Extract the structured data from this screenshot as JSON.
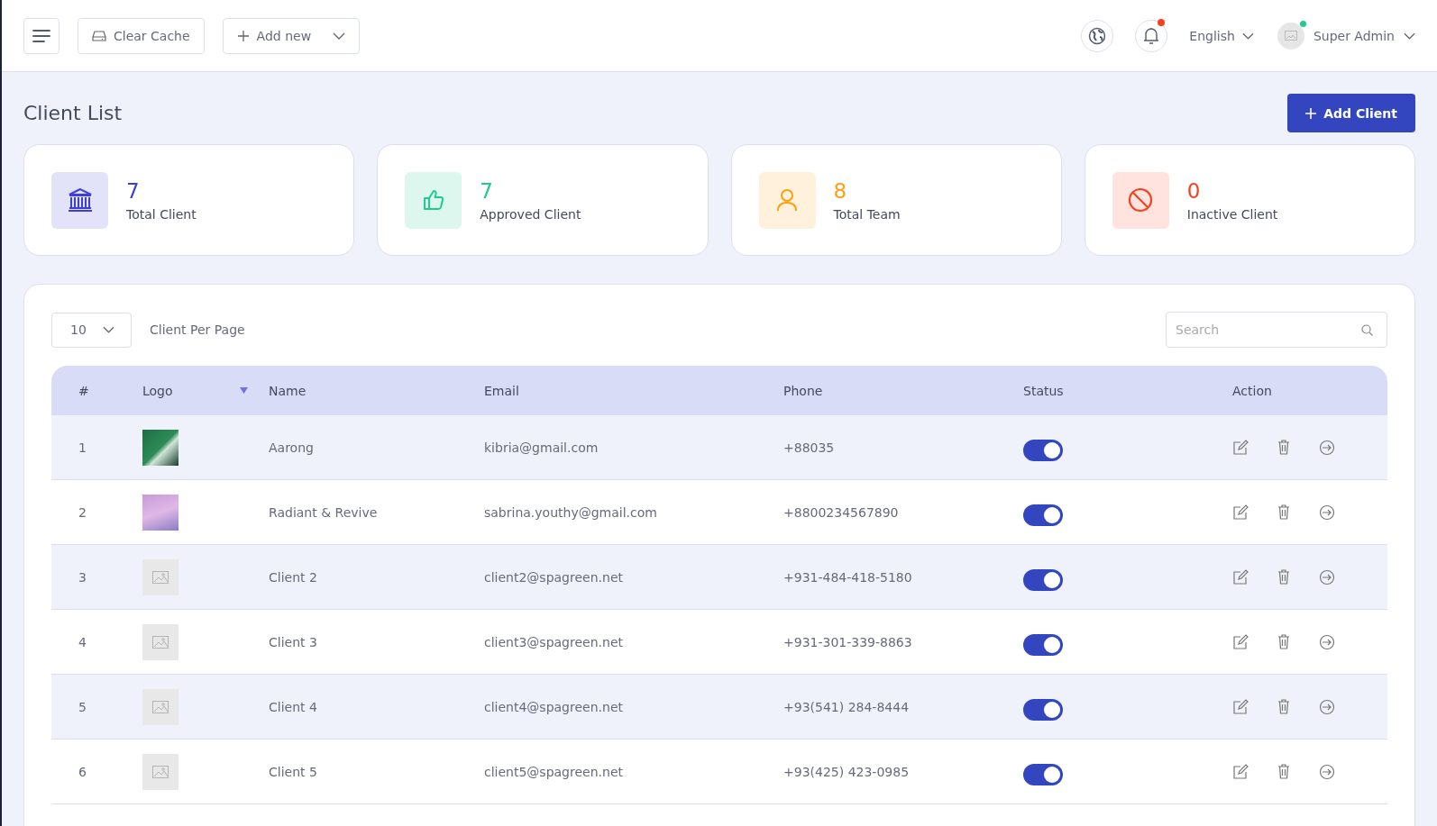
{
  "header": {
    "clear_cache": "Clear Cache",
    "add_new": "Add new",
    "language": "English",
    "user": "Super Admin",
    "notification_unread": true,
    "user_online": true
  },
  "page_title": "Client List",
  "add_button": "Add Client",
  "stats": [
    {
      "kind": "bank",
      "value": "7",
      "label": "Total Client",
      "color": "#3d3fd8"
    },
    {
      "kind": "thumb",
      "value": "7",
      "label": "Approved Client",
      "color": "#1fcb8e"
    },
    {
      "kind": "user",
      "value": "8",
      "label": "Total Team",
      "color": "#ff9f10"
    },
    {
      "kind": "ban",
      "value": "0",
      "label": "Inactive Client",
      "color": "#f5411f"
    }
  ],
  "per_page": {
    "value": "10",
    "label": "Client Per Page"
  },
  "search": {
    "placeholder": "Search"
  },
  "table": {
    "columns": [
      "#",
      "Logo",
      "Name",
      "Email",
      "Phone",
      "Status",
      "Action"
    ],
    "rows": [
      {
        "index": "1",
        "kind": "photo",
        "name": "Aarong",
        "email": "kibria@gmail.com",
        "phone": "+88035",
        "on": true
      },
      {
        "index": "2",
        "kind": "photo",
        "name": "Radiant & Revive",
        "email": "sabrina.youthy@gmail.com",
        "phone": "+8800234567890",
        "on": true
      },
      {
        "index": "3",
        "kind": "empty",
        "name": "Client 2",
        "email": "client2@spagreen.net",
        "phone": "+931-484-418-5180",
        "on": true
      },
      {
        "index": "4",
        "kind": "empty",
        "name": "Client 3",
        "email": "client3@spagreen.net",
        "phone": "+931-301-339-8863",
        "on": true
      },
      {
        "index": "5",
        "kind": "empty",
        "name": "Client 4",
        "email": "client4@spagreen.net",
        "phone": "+93(541) 284-8444",
        "on": true
      },
      {
        "index": "6",
        "kind": "empty",
        "name": "Client 5",
        "email": "client5@spagreen.net",
        "phone": "+93(425) 423-0985",
        "on": true
      }
    ]
  }
}
